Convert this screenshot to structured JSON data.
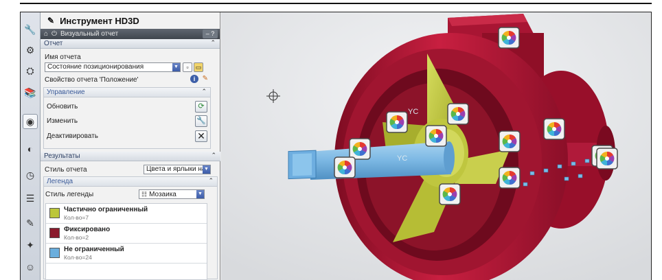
{
  "panel": {
    "title": "Инструмент HD3D",
    "subtitle": "Визуальный отчет",
    "report_section": {
      "header": "Отчет",
      "name_label": "Имя отчета",
      "name_value": "Состояние позиционирования",
      "property_label": "Свойство отчета 'Положение'",
      "management": {
        "header": "Управление",
        "actions": [
          {
            "label": "Обновить",
            "icon": "refresh-icon"
          },
          {
            "label": "Изменить",
            "icon": "wrench-icon"
          },
          {
            "label": "Деактивировать",
            "icon": "close-icon"
          }
        ]
      }
    },
    "results_section": {
      "header": "Результаты",
      "style_label": "Стиль отчета",
      "style_value": "Цвета и ярлыки на",
      "legend": {
        "header": "Легенда",
        "style_label": "Стиль легенды",
        "style_value": "Мозаика",
        "items": [
          {
            "name": "Частично ограниченный",
            "count": "Кол-во=7",
            "color": "#bcc63a"
          },
          {
            "name": "Фиксировано",
            "count": "Кол-во=2",
            "color": "#8a1a2c"
          },
          {
            "name": "Не ограниченный",
            "count": "Кол-во=24",
            "color": "#6aaedd"
          }
        ]
      }
    }
  },
  "viewport": {
    "label_yc": "YC"
  },
  "colors": {
    "housing": "#a81533",
    "rotor": "#c6cd45",
    "shaft": "#7bb7e3",
    "panel_header": "#4a5058"
  }
}
